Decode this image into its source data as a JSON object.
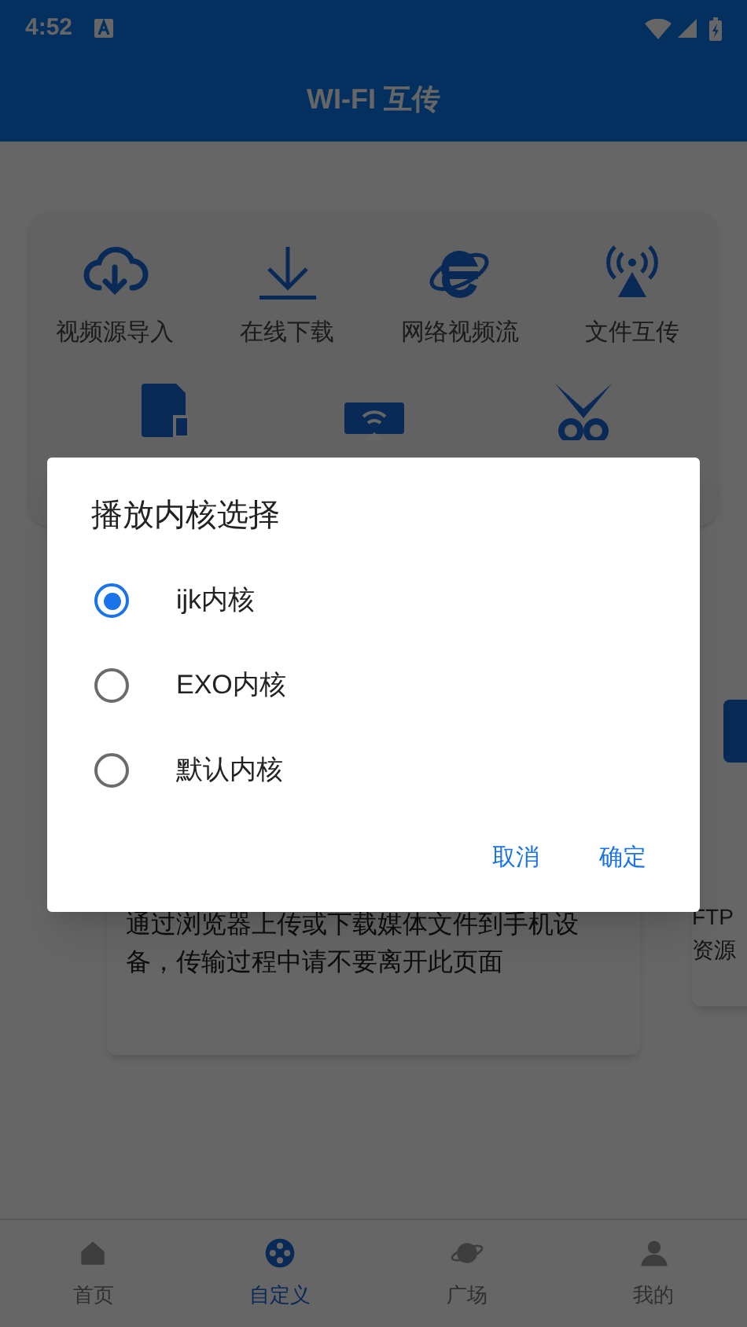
{
  "status_bar": {
    "time": "4:52"
  },
  "app_bar": {
    "title": "WI-FI 互传"
  },
  "features": [
    {
      "label": "视频源导入"
    },
    {
      "label": "在线下载"
    },
    {
      "label": "网络视频流"
    },
    {
      "label": "文件互传"
    }
  ],
  "info_card": {
    "text": "通过浏览器上传或下载媒体文件到手机设备，传输过程中请不要离开此页面"
  },
  "side_card": {
    "lines": [
      "FTP",
      "资源"
    ]
  },
  "dialog": {
    "title": "播放内核选择",
    "options": [
      {
        "label": "ijk内核",
        "selected": true
      },
      {
        "label": "EXO内核",
        "selected": false
      },
      {
        "label": "默认内核",
        "selected": false
      }
    ],
    "buttons": [
      "取消",
      "确定"
    ]
  },
  "bottom_nav": [
    {
      "label": "首页",
      "selected": false
    },
    {
      "label": "自定义",
      "selected": true
    },
    {
      "label": "广场",
      "selected": false
    },
    {
      "label": "我的",
      "selected": false
    }
  ]
}
